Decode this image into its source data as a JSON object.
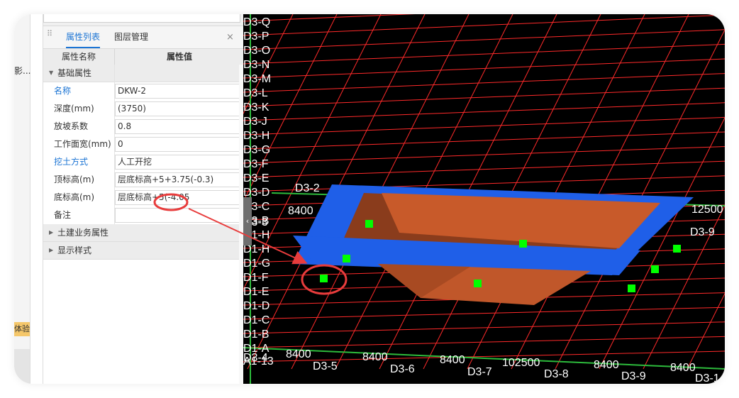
{
  "left_strip": {
    "text": "影...",
    "badge": "体验"
  },
  "panel": {
    "tabs": [
      {
        "label": "属性列表",
        "active": true
      },
      {
        "label": "图层管理",
        "active": false
      }
    ],
    "close_glyph": "×",
    "grip_glyph": "⠿",
    "columns": {
      "name": "属性名称",
      "value": "属性值"
    },
    "groups": {
      "basic": "基础属性",
      "civil": "土建业务属性",
      "display": "显示样式"
    },
    "properties": [
      {
        "name": "名称",
        "value": "DKW-2",
        "highlight": true
      },
      {
        "name": "深度(mm)",
        "value": "(3750)",
        "highlight": false
      },
      {
        "name": "放坡系数",
        "value": "0.8",
        "highlight": false
      },
      {
        "name": "工作面宽(mm)",
        "value": "0",
        "highlight": false
      },
      {
        "name": "挖土方式",
        "value": "人工开挖",
        "highlight": true
      },
      {
        "name": "顶标高(m)",
        "value": "层底标高+5+3.75(-0.3)",
        "highlight": false
      },
      {
        "name": "底标高(m)",
        "value": "层底标高+5(-4.05",
        "highlight": false
      },
      {
        "name": "备注",
        "value": "",
        "highlight": false
      }
    ],
    "collapse_glyph": "‹"
  },
  "viewport": {
    "colors": {
      "background": "#000000",
      "grid": "#ff2a2a",
      "axis": "#2dbb3c",
      "pit_top": "#1f5fe8",
      "pit_inner": "#c85a2a",
      "pit_dark": "#8a3c1c",
      "handle": "#00ff00",
      "annotation": "#e83c3c"
    },
    "axis_labels": [
      "D3-Q",
      "D3-P",
      "D3-O",
      "D3-N",
      "D3-M",
      "D3-L",
      "D3-K",
      "D3-J",
      "D3-H",
      "D3-G",
      "D3-F",
      "D3-E",
      "D3-D",
      "D3-C",
      "D3-B",
      "D1-H",
      "D1-G",
      "D1-F",
      "D1-E",
      "D1-D",
      "D1-C",
      "D1-B",
      "D1-A",
      "A1-13"
    ],
    "bottom_labels": [
      "D3-4",
      "D3-5",
      "D3-6",
      "D3-7",
      "D3-8",
      "D3-9",
      "D3-1"
    ],
    "spacing_labels": [
      "8400",
      "8400",
      "8400",
      "102500",
      "8400",
      "8400"
    ],
    "top_labels": [
      "D3-2",
      "8400",
      "D3-9",
      "12500"
    ],
    "overlap_labels": [
      "D3-3",
      "D1-H"
    ]
  }
}
